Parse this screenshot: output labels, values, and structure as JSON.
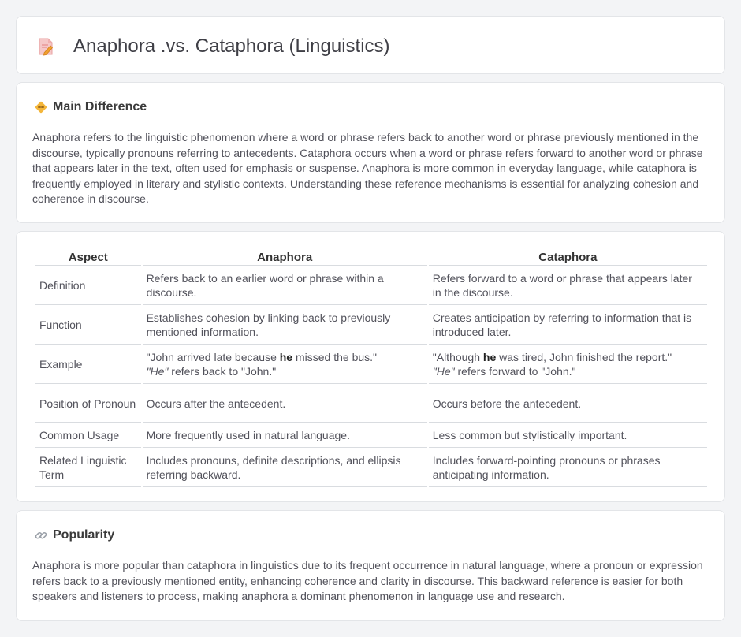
{
  "header": {
    "title": "Anaphora .vs. Cataphora (Linguistics)",
    "icon": "document-edit-icon"
  },
  "main_difference": {
    "title": "Main Difference",
    "icon": "diamond-warning-icon",
    "text": "Anaphora refers to the linguistic phenomenon where a word or phrase refers back to another word or phrase previously mentioned in the discourse, typically pronouns referring to antecedents. Cataphora occurs when a word or phrase refers forward to another word or phrase that appears later in the text, often used for emphasis or suspense. Anaphora is more common in everyday language, while cataphora is frequently employed in literary and stylistic contexts. Understanding these reference mechanisms is essential for analyzing cohesion and coherence in discourse."
  },
  "comparison": {
    "headers": [
      "Aspect",
      "Anaphora",
      "Cataphora"
    ],
    "rows": [
      {
        "aspect": "Definition",
        "anaphora": "Refers back to an earlier word or phrase within a discourse.",
        "cataphora": "Refers forward to a word or phrase that appears later in the discourse."
      },
      {
        "aspect": "Function",
        "anaphora": "Establishes cohesion by linking back to previously mentioned information.",
        "cataphora": "Creates anticipation by referring to information that is introduced later."
      },
      {
        "aspect": "Example",
        "anaphora_example": {
          "pre": "\"John arrived late because ",
          "bold": "he",
          "post": " missed the bus.\"",
          "em": "\"He\"",
          "note": " refers back to \"John.\""
        },
        "cataphora_example": {
          "pre": "\"Although ",
          "bold": "he",
          "post": " was tired, John finished the report.\"",
          "em": "\"He\"",
          "note": " refers forward to \"John.\""
        }
      },
      {
        "aspect": "Position of Pronoun",
        "anaphora": "Occurs after the antecedent.",
        "cataphora": "Occurs before the antecedent."
      },
      {
        "aspect": "Common Usage",
        "anaphora": "More frequently used in natural language.",
        "cataphora": "Less common but stylistically important."
      },
      {
        "aspect": "Related Linguistic Term",
        "anaphora": "Includes pronouns, definite descriptions, and ellipsis referring backward.",
        "cataphora": "Includes forward-pointing pronouns or phrases anticipating information."
      }
    ]
  },
  "popularity": {
    "title": "Popularity",
    "icon": "link-icon",
    "text": "Anaphora is more popular than cataphora in linguistics due to its frequent occurrence in natural language, where a pronoun or expression refers back to a previously mentioned entity, enhancing coherence and clarity in discourse. This backward reference is easier for both speakers and listeners to process, making anaphora a dominant phenomenon in language use and research."
  }
}
